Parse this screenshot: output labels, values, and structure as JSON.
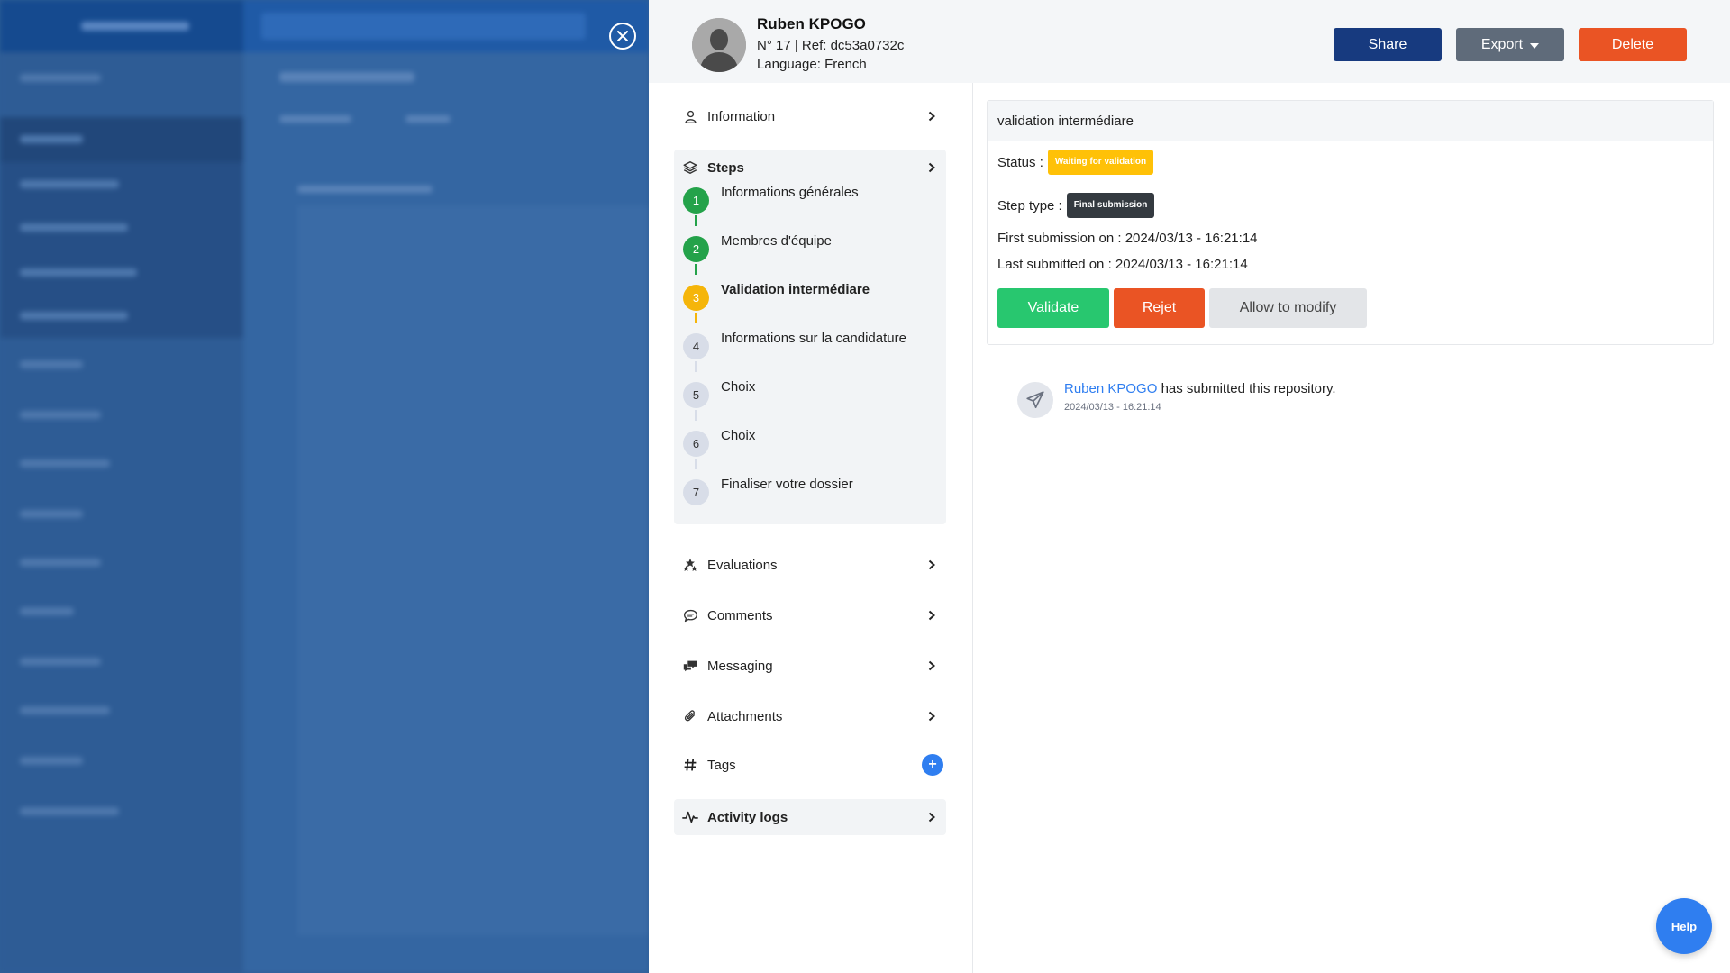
{
  "header": {
    "name": "Ruben KPOGO",
    "ref": "N° 17 | Ref: dc53a0732c",
    "language": "Language: French",
    "share_label": "Share",
    "export_label": "Export",
    "delete_label": "Delete"
  },
  "nav": {
    "information": "Information",
    "steps": "Steps",
    "evaluations": "Evaluations",
    "comments": "Comments",
    "messaging": "Messaging",
    "attachments": "Attachments",
    "tags": "Tags",
    "tags_add": "+",
    "activity_logs": "Activity logs"
  },
  "steps": [
    {
      "num": "1",
      "label": "Informations générales",
      "state": "done"
    },
    {
      "num": "2",
      "label": "Membres d'équipe",
      "state": "done"
    },
    {
      "num": "3",
      "label": "Validation intermédiare",
      "state": "current"
    },
    {
      "num": "4",
      "label": "Informations sur la candidature",
      "state": "todo"
    },
    {
      "num": "5",
      "label": "Choix",
      "state": "todo"
    },
    {
      "num": "6",
      "label": "Choix",
      "state": "todo"
    },
    {
      "num": "7",
      "label": "Finaliser votre dossier",
      "state": "todo"
    }
  ],
  "step_detail": {
    "title": "validation intermédiare",
    "status_label": "Status :",
    "status_value": "Waiting for validation",
    "type_label": "Step type :",
    "type_value": "Final submission",
    "first_submission": "First submission on : 2024/03/13 - 16:21:14",
    "last_submitted": "Last submitted on : 2024/03/13 - 16:21:14",
    "validate_label": "Validate",
    "reject_label": "Rejet",
    "modify_label": "Allow to modify"
  },
  "activity": {
    "user": "Ruben KPOGO",
    "text": "has submitted this repository.",
    "date": "2024/03/13 - 16:21:14"
  },
  "help_label": "Help",
  "colors": {
    "done": "#24a24a",
    "current": "#f5b50a",
    "todo": "#d8dde8",
    "primary": "#173a7f",
    "danger": "#ea5424",
    "success": "#28c76f"
  }
}
